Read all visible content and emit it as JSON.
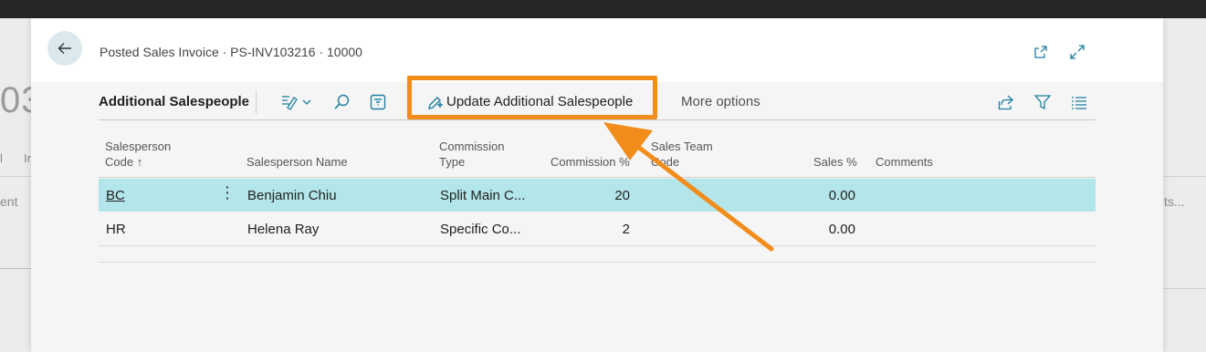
{
  "background": {
    "big_number": "03",
    "tab_a": "l",
    "tab_b": "In",
    "field_a": "ent",
    "field_b": "ts..."
  },
  "dialog": {
    "title": "Posted Sales Invoice · PS-INV103216 · 10000",
    "back_icon": "arrow-left-icon",
    "open_new_icon": "open-in-new-window-icon",
    "expand_icon": "expand-icon"
  },
  "toolbar": {
    "title": "Additional Salespeople",
    "edit_icon": "edit-list-icon",
    "search_icon": "search-icon",
    "filter_pane_icon": "filter-pane-icon",
    "update_label": "Update Additional Salespeople",
    "more_label": "More options",
    "share_icon": "share-icon",
    "filter_icon": "filter-icon",
    "list_icon": "list-icon"
  },
  "table": {
    "headers": {
      "code": [
        "Salesperson",
        "Code ↑"
      ],
      "name": "Salesperson Name",
      "commission_type": [
        "Commission",
        "Type"
      ],
      "commission_pct": "Commission %",
      "team_code": [
        "Sales Team",
        "Code"
      ],
      "sales_pct": "Sales %",
      "comments": "Comments"
    },
    "rows": [
      {
        "code": "BC",
        "name": "Benjamin Chiu",
        "commission_type": "Split Main C...",
        "commission_pct": "20",
        "team_code": "",
        "sales_pct": "0.00",
        "comments": ""
      },
      {
        "code": "HR",
        "name": "Helena Ray",
        "commission_type": "Specific Co...",
        "commission_pct": "2",
        "team_code": "",
        "sales_pct": "0.00",
        "comments": ""
      }
    ]
  },
  "colors": {
    "highlight": "#f28c1b",
    "selected_row": "#b3e6ea",
    "accent": "#1f7ea1"
  }
}
